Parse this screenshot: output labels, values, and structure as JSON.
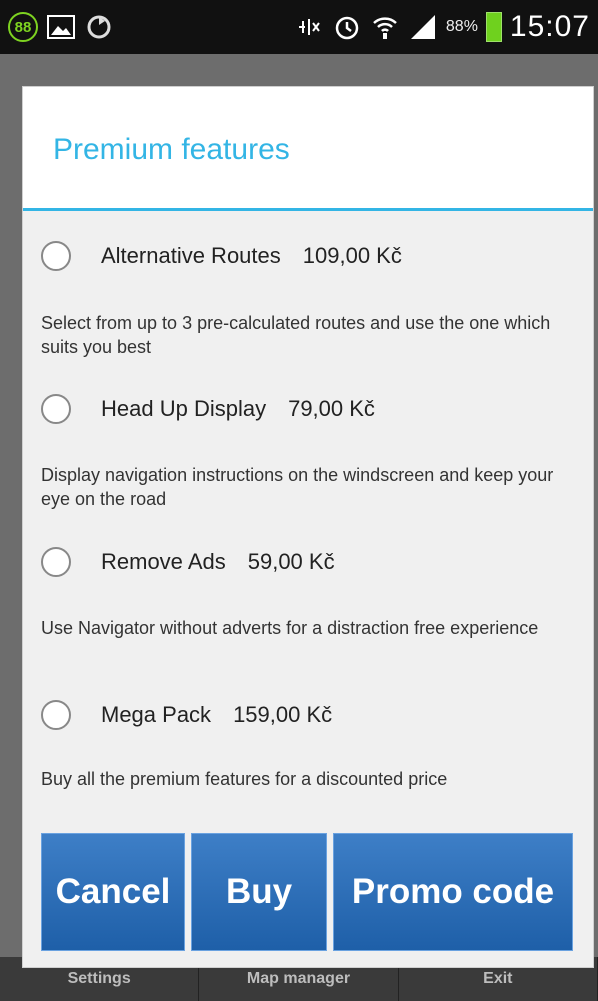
{
  "statusbar": {
    "badge": "88",
    "battery_pct": "88%",
    "clock": "15:07",
    "icons": [
      "image-icon",
      "sync-icon",
      "nfc-icon",
      "alarm-icon",
      "wifi-icon",
      "signal-icon",
      "battery-icon"
    ]
  },
  "dialog": {
    "title": "Premium features",
    "accent_color": "#33b5e5",
    "options": [
      {
        "name": "Alternative Routes",
        "price": "109,00 Kč",
        "description": "Select from up to 3 pre-calculated routes and use the one which suits you best"
      },
      {
        "name": "Head Up Display",
        "price": "79,00 Kč",
        "description": "Display navigation instructions on the windscreen and keep your eye on the road"
      },
      {
        "name": "Remove Ads",
        "price": "59,00 Kč",
        "description": "Use Navigator without adverts for a distraction free experience"
      },
      {
        "name": "Mega Pack",
        "price": "159,00 Kč",
        "description": "Buy all the premium features for a discounted price"
      }
    ],
    "buttons": {
      "cancel": "Cancel",
      "buy": "Buy",
      "promo": "Promo code"
    }
  },
  "bottom_tabs": [
    "Settings",
    "Map manager",
    "Exit"
  ]
}
